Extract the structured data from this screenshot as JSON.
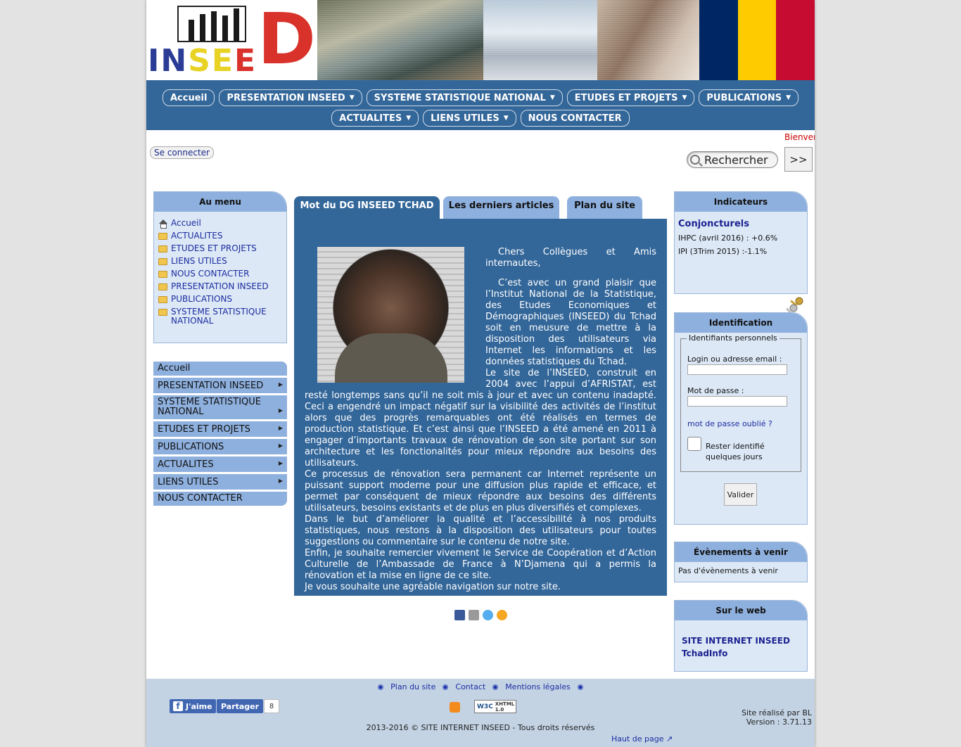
{
  "colors": {
    "nav_bg": "#336699",
    "box_title_bg": "#8eb0de",
    "box_bg": "#dce8f6",
    "footer_bg": "#c3d3e4",
    "link": "#1c2ca0",
    "welcome": "#cc0000"
  },
  "banner": {
    "logo_text": "INSEED"
  },
  "nav": {
    "row1": [
      {
        "label": "Accueil",
        "dropdown": false
      },
      {
        "label": "PRESENTATION INSEED",
        "dropdown": true
      },
      {
        "label": "SYSTEME STATISTIQUE NATIONAL",
        "dropdown": true
      },
      {
        "label": "ETUDES ET PROJETS",
        "dropdown": true
      },
      {
        "label": "PUBLICATIONS",
        "dropdown": true
      }
    ],
    "row2": [
      {
        "label": "ACTUALITES",
        "dropdown": true
      },
      {
        "label": "LIENS UTILES",
        "dropdown": true
      },
      {
        "label": "NOUS CONTACTER",
        "dropdown": false
      }
    ],
    "arrow": "▼"
  },
  "top": {
    "welcome": "Bienvenue",
    "connect": "Se connecter",
    "search_value": "Rechercher",
    "search_go": ">>"
  },
  "aumenu": {
    "title": "Au menu",
    "items": [
      "Accueil",
      "ACTUALITES",
      "ETUDES ET PROJETS",
      "LIENS UTILES",
      "NOUS CONTACTER",
      "PRESENTATION INSEED",
      "PUBLICATIONS",
      "SYSTEME STATISTIQUE NATIONAL"
    ]
  },
  "accordion": {
    "items": [
      "Accueil",
      "PRESENTATION INSEED",
      "SYSTEME STATISTIQUE NATIONAL",
      "ETUDES ET PROJETS",
      "PUBLICATIONS",
      "ACTUALITES",
      "LIENS UTILES",
      "NOUS CONTACTER"
    ],
    "arrow": "▶"
  },
  "tabs": [
    "Mot du DG INSEED TCHAD",
    "Les derniers articles",
    "Plan du site"
  ],
  "article": {
    "p1": "Chers Collègues et Amis internautes,",
    "p2": "C’est avec un grand plaisir que l’Institut National de la Statistique, des Etudes Economiques et Démographiques (INSEED) du Tchad soit en meusure de mettre à la disposition des utilisateurs via Internet les informations et les données statistiques du Tchad.",
    "p3": "Le site de l’INSEED, construit en 2004 avec l’appui d’AFRISTAT, est resté longtemps sans qu’il ne soit mis à jour et avec un contenu inadapté. Ceci a engendré un impact négatif sur la visibilité des activités de l’institut alors que des progrès remarquables ont été réalisés en termes de production statistique. Et c’est ainsi que l’INSEED a été amené en 2011 à engager d’importants travaux de rénovation de son site portant sur son architecture et les fonctionalités pour mieux répondre aux besoins des utilisateurs.",
    "p4": "Ce processus de rénovation sera permanent car Internet représente un puissant support moderne pour une diffusion plus rapide et efficace, et permet par conséquent de mieux répondre aux besoins des différents utilisateurs, besoins existants et de plus en plus diversifiés et complexes.",
    "p5": "Dans le but d’améliorer la qualité et l’accessibilité à nos produits statistiques, nous restons à la disposition des utilisateurs pour toutes suggestions ou commentaire sur le contenu de notre site.",
    "p6": "Enfin, je souhaite remercier vivement le Service de Coopération et d’Action Culturelle de l’Ambassade de France à N’Djamena qui a permis la rénovation et la mise en ligne de ce site.",
    "p7": "Je vous souhaite une agréable navigation sur notre site."
  },
  "indicateurs": {
    "title": "Indicateurs",
    "heading": "Conjoncturels",
    "lines": [
      "IHPC (avril 2016) : +0.6%",
      "IPI (3Trim 2015) :-1.1%"
    ]
  },
  "identification": {
    "title": "Identification",
    "legend": "Identifiants personnels",
    "login_label": "Login ou adresse email :",
    "password_label": "Mot de passe :",
    "forgot": "mot de passe oublié ?",
    "remember": "Rester identifié quelques jours",
    "submit": "Valider"
  },
  "evenements": {
    "title": "Évènements à venir",
    "body": "Pas d'évènements à venir"
  },
  "surweb": {
    "title": "Sur le web",
    "links": [
      "SITE INTERNET INSEED",
      "TchadInfo"
    ]
  },
  "footer": {
    "links": [
      "Plan du site",
      "Contact",
      "Mentions légales"
    ],
    "fb_like": "J'aime",
    "fb_share": "Partager",
    "fb_count": "8",
    "w3c": "XHTML 1.0",
    "copyright": "2013-2016 © SITE INTERNET INSEED - Tous droits réservés",
    "credit_line1": "Site réalisé par BL",
    "credit_line2": "Version : 3.71.13",
    "top_link": "Haut de page"
  }
}
